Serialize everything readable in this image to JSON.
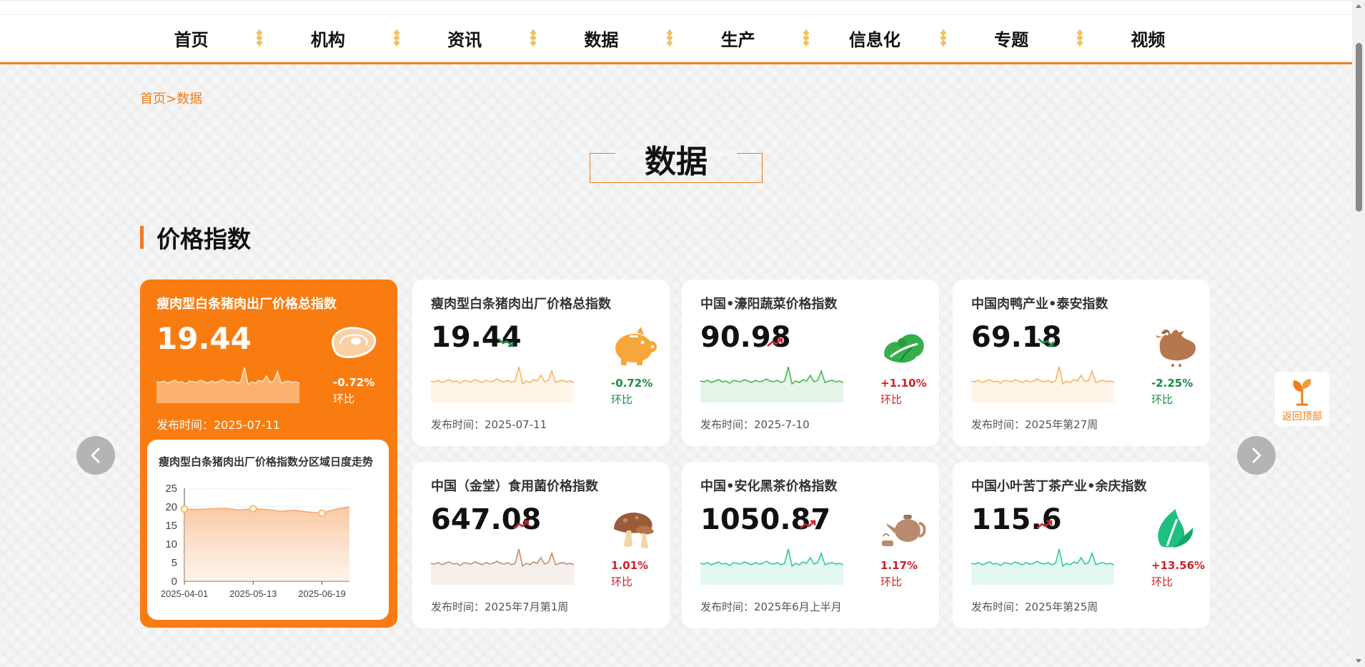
{
  "nav": {
    "items": [
      "首页",
      "机构",
      "资讯",
      "数据",
      "生产",
      "信息化",
      "专题",
      "视频"
    ]
  },
  "breadcrumb": "首页>数据",
  "page_title": "数据",
  "section_title": "价格指数",
  "featured": {
    "title": "瘦肉型白条猪肉出厂价格总指数",
    "value": "19.44",
    "change": "-0.72%",
    "change_label": "环比",
    "date": "发布时间：2025-07-11",
    "icon": "meat-icon",
    "chart_title": "瘦肉型白条猪肉出厂价格指数分区域日度走势"
  },
  "cards": [
    {
      "title": "瘦肉型白条猪肉出厂价格总指数",
      "value": "19.44",
      "trend": "down",
      "change": "-0.72%",
      "change_label": "环比",
      "date": "发布时间：2025-07-11",
      "icon": "pig-icon",
      "color": "#f6b255"
    },
    {
      "title": "中国•濠阳蔬菜价格指数",
      "value": "90.98",
      "trend": "up",
      "change": "+1.10%",
      "change_label": "环比",
      "date": "发布时间：2025-7-10",
      "icon": "vegetable-icon",
      "color": "#3bb54a"
    },
    {
      "title": "中国肉鸭产业•泰安指数",
      "value": "69.18",
      "trend": "down",
      "change": "-2.25%",
      "change_label": "环比",
      "date": "发布时间：2025年第27周",
      "icon": "duck-icon",
      "color": "#f6b255"
    },
    {
      "title": "中国（金堂）食用菌价格指数",
      "value": "647.08",
      "trend": "up",
      "change": "1.01%",
      "change_label": "环比",
      "date": "发布时间：2025年7月第1周",
      "icon": "mushroom-icon",
      "color": "#b98b6e"
    },
    {
      "title": "中国•安化黑茶价格指数",
      "value": "1050.87",
      "trend": "up",
      "change": "1.17%",
      "change_label": "环比",
      "date": "发布时间：2025年6月上半月",
      "icon": "teapot-icon",
      "color": "#27c98f"
    },
    {
      "title": "中国小叶苦丁茶产业•余庆指数",
      "value": "115.6",
      "trend": "up",
      "change": "+13.56%",
      "change_label": "环比",
      "date": "发布时间：2025年第25周",
      "icon": "tea-leaf-icon",
      "color": "#27c98f"
    }
  ],
  "colors": {
    "accent": "#f07c1b",
    "featured_bg": "#f97c11",
    "up": "#d0202a",
    "down": "#1e8a45"
  },
  "back_to_top": "返回顶部",
  "chart_data": {
    "type": "area",
    "title": "瘦肉型白条猪肉出厂价格指数分区域日度走势",
    "x_ticks": [
      "2025-04-01",
      "2025-05-13",
      "2025-06-19"
    ],
    "y_ticks": [
      "25",
      "20",
      "15",
      "10",
      "5",
      "0"
    ],
    "ylim": [
      0,
      25
    ],
    "series": [
      {
        "values": [
          19.4,
          19.3,
          19.5,
          19.6,
          19.2,
          19.5,
          19.3,
          18.8,
          19.1,
          18.6,
          18.3,
          19.4,
          20.0
        ]
      }
    ],
    "markers": [
      [
        0,
        19.4
      ],
      [
        5,
        19.5
      ],
      [
        10,
        18.3
      ]
    ],
    "grid": "horizontal"
  }
}
